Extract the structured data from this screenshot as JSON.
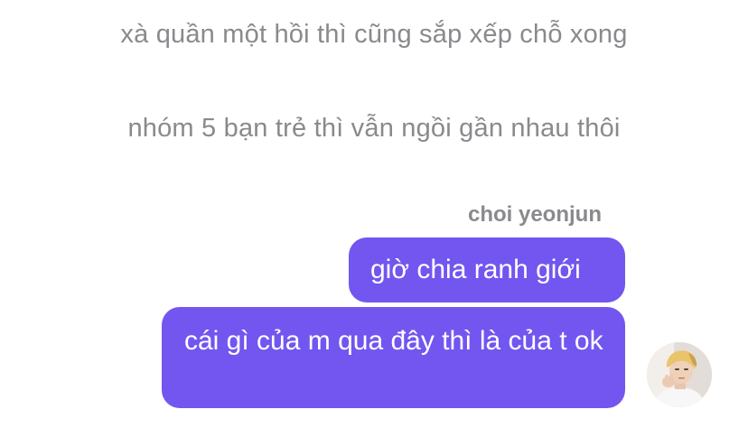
{
  "narration": {
    "line1": "xà quần một hồi thì cũng sắp xếp chỗ xong",
    "line2": "nhóm 5 bạn trẻ thì vẫn ngồi gần nhau thôi"
  },
  "chat": {
    "sender_name": "choi yeonjun",
    "messages": [
      {
        "text": "giờ chia ranh giới"
      },
      {
        "text": "cái gì của m qua đây thì là của t ok"
      }
    ],
    "avatar_icon": "person-photo-avatar"
  },
  "colors": {
    "bubble": "#7256ef",
    "narration_text": "#8a8a8e",
    "bubble_text": "#ffffff"
  }
}
